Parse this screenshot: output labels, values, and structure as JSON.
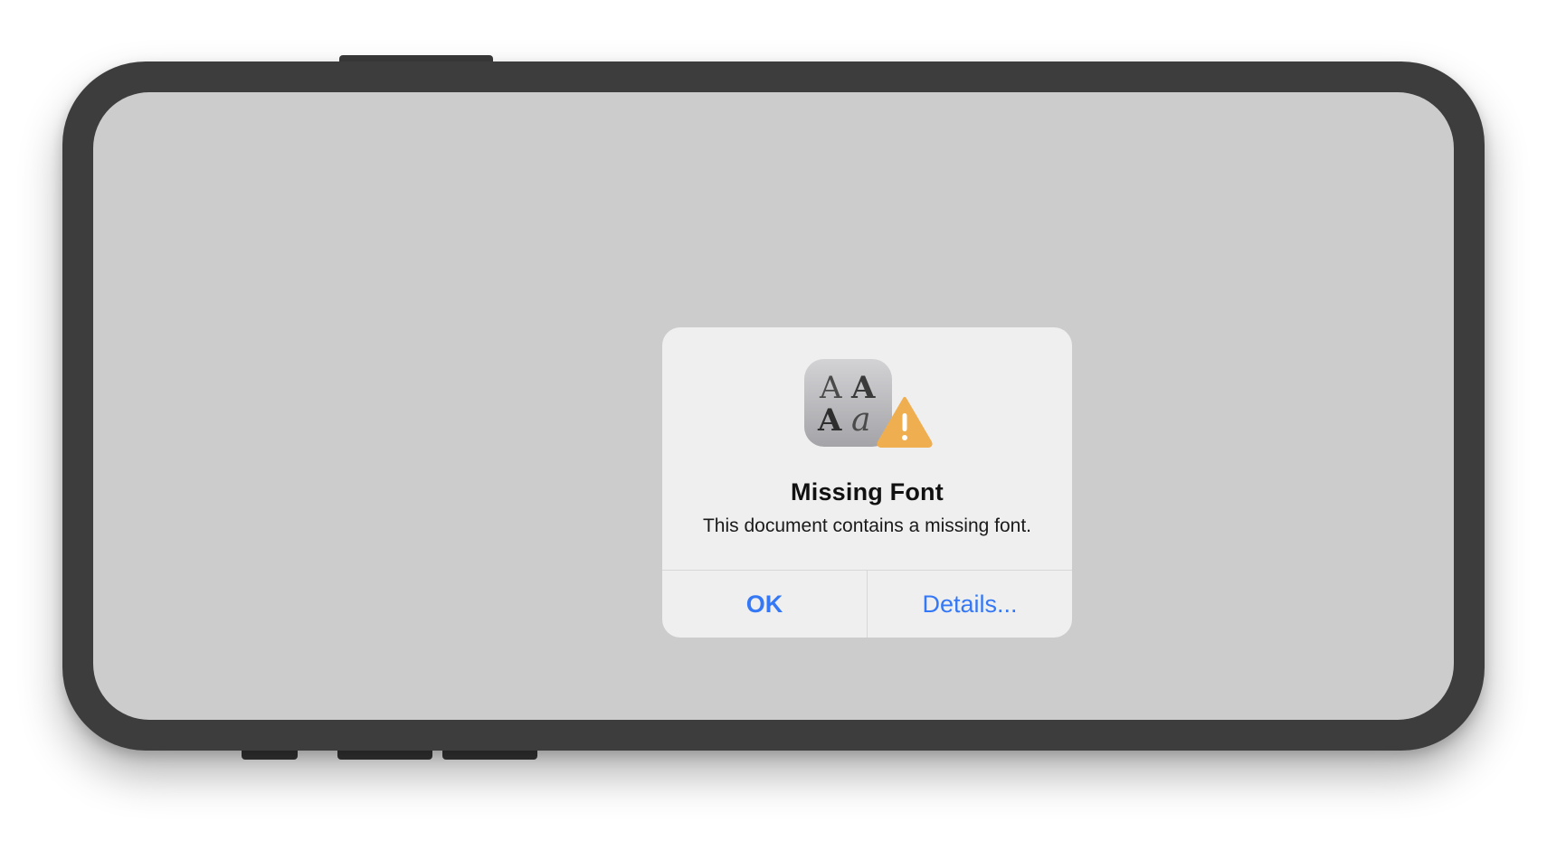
{
  "alert": {
    "icon": "missing-font-icon",
    "icon_badge": "warning-icon",
    "title": "Missing Font",
    "message": "This document contains a missing font.",
    "buttons": [
      {
        "label": "OK",
        "default": true
      },
      {
        "label": "Details..."
      }
    ]
  },
  "colors": {
    "accent": "#3478f6",
    "warning": "#efae4f",
    "device_frame": "#3d3d3d",
    "screen_background": "#cccccc",
    "alert_background": "#efefef"
  }
}
